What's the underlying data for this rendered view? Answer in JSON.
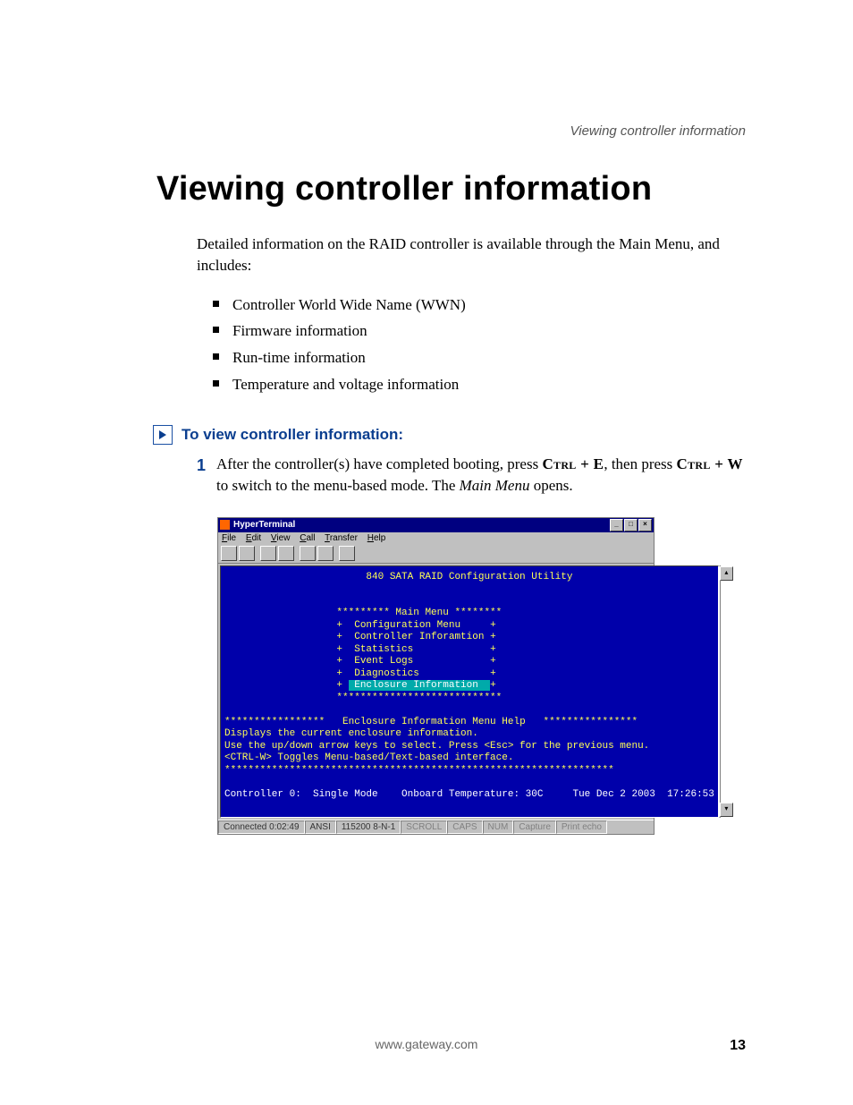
{
  "running_head": "Viewing controller information",
  "title": "Viewing controller information",
  "intro": "Detailed information on the RAID controller is available through the Main Menu, and includes:",
  "bullets": [
    "Controller World Wide Name (WWN)",
    "Firmware information",
    "Run-time information",
    "Temperature and voltage information"
  ],
  "proc_heading": "To view controller information:",
  "step": {
    "num": "1",
    "pre": "After the controller(s) have completed booting, press ",
    "key1": "Ctrl + E",
    "mid": ", then press ",
    "key2": "Ctrl + W",
    "post1": " to switch to the menu-based mode. The ",
    "ital": "Main Menu",
    "post2": " opens."
  },
  "terminal": {
    "window_title": "HyperTerminal",
    "menus": [
      "File",
      "Edit",
      "View",
      "Call",
      "Transfer",
      "Help"
    ],
    "banner": "840 SATA RAID Configuration Utility",
    "menu_header": "********* Main Menu ********",
    "items": [
      "Configuration Menu",
      "Controller Inforamtion",
      "Statistics",
      "Event Logs",
      "Diagnostics",
      "Enclosure Information"
    ],
    "menu_footer": "****************************",
    "help_header_l": "*****************",
    "help_title": "Enclosure Information Menu Help",
    "help_header_r": "****************",
    "help_lines": [
      "Displays the current enclosure information.",
      "Use the up/down arrow keys to select. Press <Esc> for the previous menu.",
      "<CTRL-W> Toggles Menu-based/Text-based interface."
    ],
    "help_footer": "******************************************************************",
    "status_line": "Controller 0:  Single Mode    Onboard Temperature: 30C     Tue Dec 2 2003  17:26:53",
    "statusbar": {
      "conn": "Connected 0:02:49",
      "emul": "ANSI",
      "baud": "115200 8-N-1",
      "flags": [
        "SCROLL",
        "CAPS",
        "NUM",
        "Capture",
        "Print echo"
      ]
    }
  },
  "footer_url": "www.gateway.com",
  "page_number": "13"
}
